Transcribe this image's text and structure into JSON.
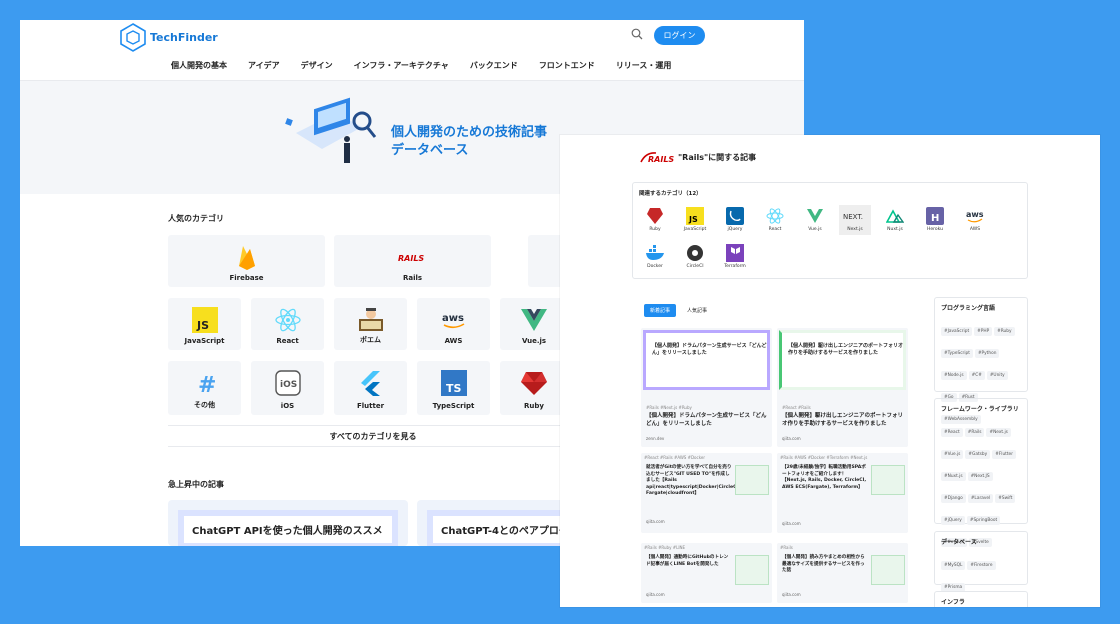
{
  "win1": {
    "logo": "TechFinder",
    "login": "ログイン",
    "nav": [
      "個人開発の基本",
      "アイデア",
      "デザイン",
      "インフラ・アーキテクチャ",
      "バックエンド",
      "フロントエンド",
      "リリース・運用"
    ],
    "hero_line1": "個人開発のための技術記事",
    "hero_line2": "データベース",
    "popular_title": "人気のカテゴリ",
    "categories": [
      "Firebase",
      "Rails",
      "JavaScript",
      "React",
      "ポエム",
      "AWS",
      "Vue.js",
      "その他",
      "iOS",
      "Flutter",
      "TypeScript",
      "Ruby"
    ],
    "all_categories": "すべてのカテゴリを見る",
    "trending_title": "急上昇中の記事",
    "trending": [
      "ChatGPT APIを使った個人開発のススメ",
      "ChatGPT-4とのペアプログ"
    ]
  },
  "win2": {
    "title": "\"Rails\"に関する記事",
    "rel_title": "関連するカテゴリ（12）",
    "rel": [
      "Ruby",
      "JavaScript",
      "jQuery",
      "React",
      "Vue.js",
      "Next.js",
      "Nuxt.js",
      "Heroku",
      "AWS",
      "Docker",
      "CircleCI",
      "Terraform"
    ],
    "tab_new": "新着記事",
    "tab_pop": "人気記事",
    "articles": [
      {
        "thumb": "【個人開発】ドラムパターン生成サービス「どんどん」をリリースしました",
        "tags": "#Rails #Next.js #Ruby",
        "title": "【個人開発】ドラムパターン生成サービス「どんどん」をリリースしました",
        "meta": "zenn.dev"
      },
      {
        "thumb": "【個人開発】駆け出しエンジニアのポートフォリオ作りを手助けするサービスを作りました",
        "tags": "#React #Rails",
        "title": "【個人開発】駆け出しエンジニアのポートフォリオ作りを手助けするサービスを作りました",
        "meta": "qiita.com"
      },
      {
        "thumb": "",
        "tags": "#React #Rails #AWS #Docker",
        "title": "就活者がGitの使い方を学べて自分を売り込むサービス\"GIT USED TO\"を作成しました【Rails api|react|typescript|Docker|CircleCI|aws Fargate|cloudfront】",
        "meta": "qiita.com"
      },
      {
        "thumb": "",
        "tags": "#Rails #AWS #Docker #Terraform #Next.js",
        "title": "【29歳/未経験/独学】転職活動用SPAポートフォリオをご紹介します！【Next.js, Rails, Docker, CircleCI, AWS ECS(Fargate), Terraform】",
        "meta": "qiita.com"
      },
      {
        "thumb": "",
        "tags": "#Rails #Ruby #LINE",
        "title": "【個人開発】通勤時にGitHubのトレンド記事が届くLINE Botを開発した",
        "meta": "qiita.com"
      },
      {
        "thumb": "",
        "tags": "#Rails",
        "title": "【個人開発】読み方やまとめの相性から最適なサイズを提供するサービスを作った話",
        "meta": "qiita.com"
      }
    ],
    "side": [
      {
        "t": "プログラミング言語",
        "chips": [
          "#JavaScript",
          "#PHP",
          "#Ruby",
          "#TypeScript",
          "#Python",
          "#Node.js",
          "#C#",
          "#Unity",
          "#Go",
          "#Rust",
          "#WebAssembly"
        ]
      },
      {
        "t": "フレームワーク・ライブラリ",
        "chips": [
          "#React",
          "#Rails",
          "#Next.js",
          "#Vue.js",
          "#Gatsby",
          "#Flutter",
          "#Nuxt.js",
          "#Next.JS",
          "#Django",
          "#Laravel",
          "#Swift",
          "#jQuery",
          "#SpringBoot",
          "#three.js",
          "#Svelte"
        ]
      },
      {
        "t": "データベース",
        "chips": [
          "#MySQL",
          "#Firestore",
          "#Prisma"
        ]
      },
      {
        "t": "インフラ",
        "chips": []
      }
    ]
  }
}
